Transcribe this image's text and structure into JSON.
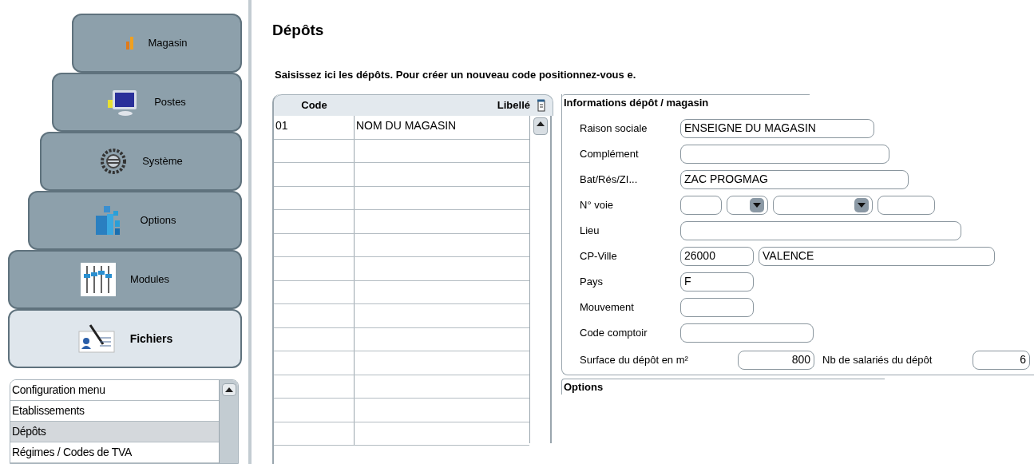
{
  "sidebar": {
    "nav": [
      {
        "label": "Magasin",
        "selected": false
      },
      {
        "label": "Postes",
        "selected": false
      },
      {
        "label": "Système",
        "selected": false
      },
      {
        "label": "Options",
        "selected": false
      },
      {
        "label": "Modules",
        "selected": false
      },
      {
        "label": "Fichiers",
        "selected": true
      }
    ],
    "list": [
      {
        "label": "Configuration menu",
        "selected": false
      },
      {
        "label": "Etablissements",
        "selected": false
      },
      {
        "label": "Dépôts",
        "selected": true
      },
      {
        "label": "Régimes / Codes de TVA",
        "selected": false
      }
    ]
  },
  "page": {
    "title": "Dépôts",
    "subtitle": "Saisissez ici les dépôts. Pour créer un nouveau code positionnez-vous e."
  },
  "table": {
    "columns": [
      "Code",
      "Libellé"
    ],
    "rows": [
      {
        "code": "01",
        "libelle": "NOM DU MAGASIN"
      }
    ]
  },
  "info": {
    "title": "Informations dépôt / magasin",
    "fields": [
      {
        "label": "Raison sociale",
        "inputs": [
          {
            "kind": "text",
            "value": "ENSEIGNE DU MAGASIN"
          }
        ]
      },
      {
        "label": "Complément",
        "inputs": [
          {
            "kind": "text"
          }
        ]
      },
      {
        "label": "Bat/Rés/ZI...",
        "inputs": [
          {
            "kind": "text",
            "value": "ZAC PROGMAG"
          }
        ]
      },
      {
        "label": "N° voie",
        "inputs": [
          {
            "kind": "text"
          },
          {
            "kind": "select"
          },
          {
            "kind": "select"
          },
          {
            "kind": "text"
          }
        ]
      },
      {
        "label": "Lieu",
        "inputs": [
          {
            "kind": "text"
          }
        ]
      },
      {
        "label": "CP-Ville",
        "inputs": [
          {
            "kind": "text",
            "value": "26000"
          },
          {
            "kind": "text",
            "value": "VALENCE"
          }
        ]
      },
      {
        "label": "Pays",
        "inputs": [
          {
            "kind": "text",
            "value": "F"
          }
        ]
      },
      {
        "label": "Mouvement",
        "inputs": [
          {
            "kind": "text"
          }
        ]
      },
      {
        "label": "Code comptoir",
        "inputs": [
          {
            "kind": "text"
          }
        ]
      }
    ],
    "surface": {
      "label": "Surface du dépôt en m²",
      "value": "800"
    },
    "staff": {
      "label": "Nb de salariés du dépôt",
      "value": "6"
    }
  },
  "options": {
    "title": "Options"
  }
}
